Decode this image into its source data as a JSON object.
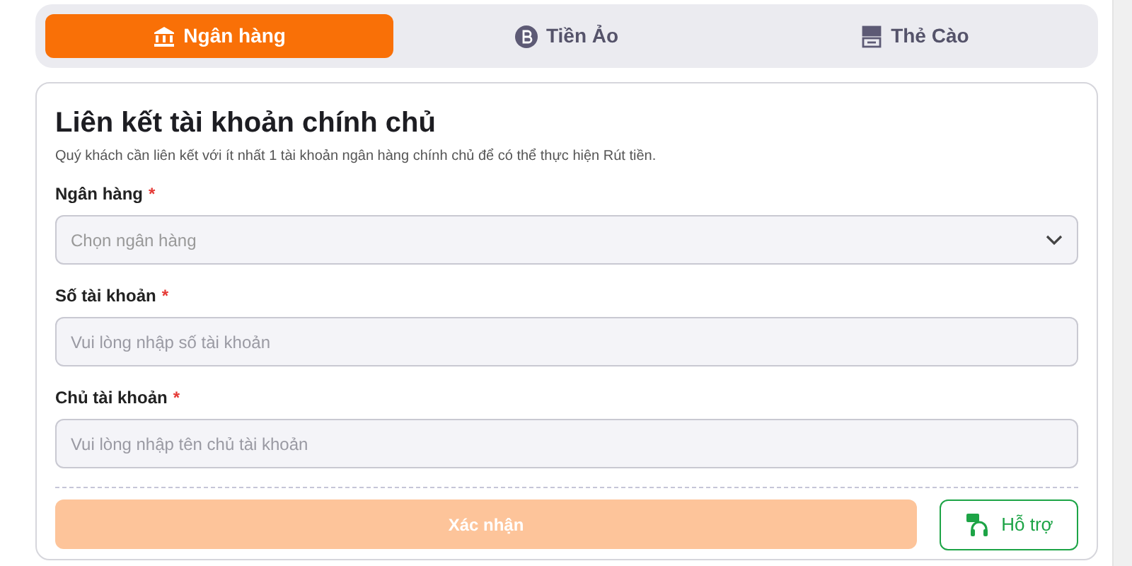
{
  "tabs": [
    {
      "label": "Ngân hàng",
      "kind": "bank",
      "selected": true
    },
    {
      "label": "Tiền Ảo",
      "kind": "coin",
      "selected": false
    },
    {
      "label": "Thẻ Cào",
      "kind": "card",
      "selected": false
    }
  ],
  "form": {
    "title": "Liên kết tài khoản chính chủ",
    "description": "Quý khách cần liên kết với ít nhất 1 tài khoản ngân hàng chính chủ để có thể thực hiện Rút tiền.",
    "fields": [
      {
        "kind": "select",
        "label": "Ngân hàng",
        "required_mark": "*",
        "placeholder": "Chọn ngân hàng"
      },
      {
        "kind": "text",
        "label": "Số tài khoản",
        "required_mark": "*",
        "placeholder": "Vui lòng nhập số tài khoản"
      },
      {
        "kind": "text",
        "label": "Chủ tài khoản",
        "required_mark": "*",
        "placeholder": "Vui lòng nhập tên chủ tài khoản"
      }
    ],
    "confirm_button": {
      "label": "Xác nhận",
      "disabled": true
    },
    "support_button": {
      "label": "Hỗ trợ"
    }
  }
}
